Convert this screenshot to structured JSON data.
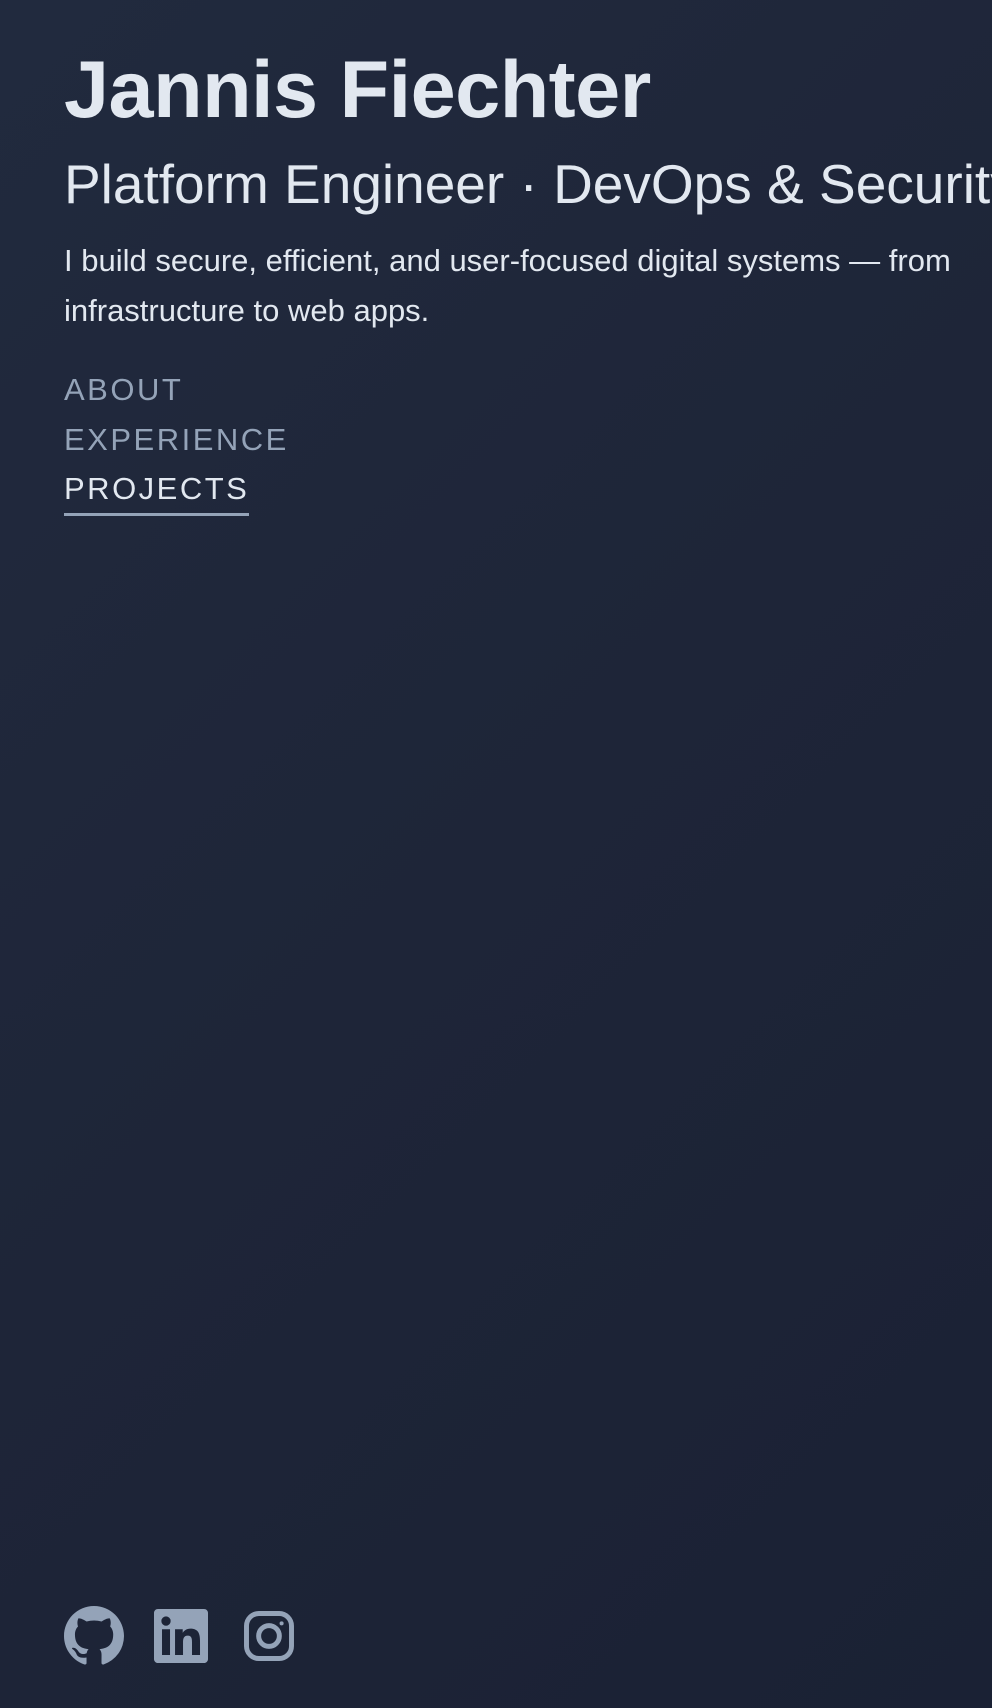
{
  "header": {
    "name": "Jannis Fiechter",
    "subtitle": "Platform Engineer · DevOps & Security",
    "tagline": "I build secure, efficient, and user-focused digital systems — from infrastructure to web apps."
  },
  "nav": {
    "items": [
      {
        "label": "ABOUT",
        "active": false
      },
      {
        "label": "EXPERIENCE",
        "active": false
      },
      {
        "label": "PROJECTS",
        "active": true
      }
    ]
  },
  "socials": [
    {
      "icon": "github-icon"
    },
    {
      "icon": "linkedin-icon"
    },
    {
      "icon": "instagram-icon"
    }
  ],
  "colors": {
    "background": "#1e2538",
    "text_primary": "#e2e8f0",
    "text_muted": "#94a3b8"
  }
}
